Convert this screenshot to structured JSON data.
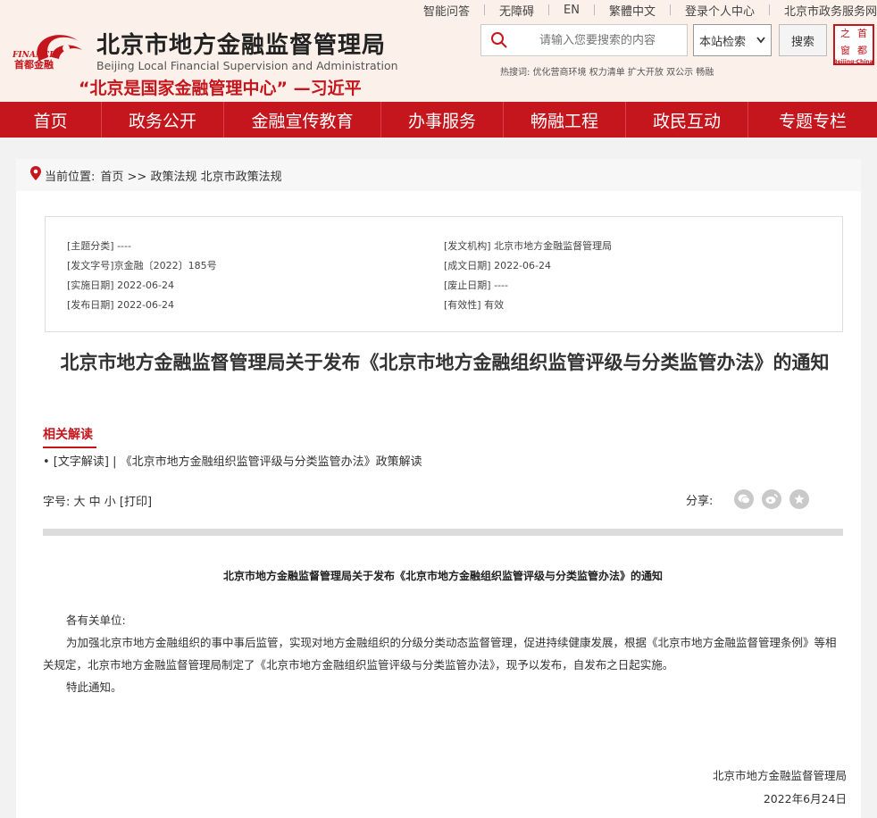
{
  "topbar": {
    "items": [
      "智能问答",
      "无障碍",
      "EN",
      "繁體中文",
      "登录个人中心",
      "北京市政务服务网"
    ]
  },
  "header": {
    "logo_text_en": "FINANCE",
    "logo_text_cn": "首都金融",
    "site_name_cn": "北京市地方金融监督管理局",
    "site_name_en": "Beijing Local Financial Supervision and Administration",
    "slogan": "“北京是国家金融管理中心” —习近平",
    "search_placeholder": "请输入您要搜索的内容",
    "search_scope": "本站检索",
    "search_button": "搜索",
    "hot_label": "热搜词:",
    "hot_words": "优化营商环境 权力清单 扩大开放 双公示 畅融",
    "stamp_chars": [
      "首",
      "都",
      "之",
      "窗"
    ],
    "stamp_en": "Beijing·China"
  },
  "nav": {
    "items": [
      "首页",
      "政务公开",
      "金融宣传教育",
      "办事服务",
      "畅融工程",
      "政民互动",
      "专题专栏"
    ]
  },
  "breadcrumb": {
    "label": "当前位置:",
    "path": "首页 >> 政策法规 北京市政策法规"
  },
  "meta": {
    "subject_category": "[主题分类] ----",
    "doc_number": "[发文字号]京金融〔2022〕185号",
    "effective_date": "[实施日期] 2022-06-24",
    "publish_date": "[发布日期] 2022-06-24",
    "issuing_body": "[发文机构] 北京市地方金融监督管理局",
    "written_date": "[成文日期] 2022-06-24",
    "repeal_date": "[废止日期] ----",
    "validity": "[有效性] 有效"
  },
  "article": {
    "title": "北京市地方金融监督管理局关于发布《北京市地方金融组织监管评级与分类监管办法》的通知",
    "related_heading": "相关解读",
    "related_item_tag": "• [文字解读] |",
    "related_item_text": "《北京市地方金融组织监管评级与分类监管办法》政策解读",
    "font_size_label": "字号: 大 中 小 [打印]",
    "share_label": "分享:",
    "doc_title": "北京市地方金融监督管理局关于发布《北京市地方金融组织监管评级与分类监管办法》的通知",
    "salutation": "各有关单位:",
    "paragraph": "为加强北京市地方金融组织的事中事后监管，实现对地方金融组织的分级分类动态监督管理，促进持续健康发展，根据《北京市地方金融监督管理条例》等相关规定，北京市地方金融监督管理局制定了《北京市地方金融组织监管评级与分类监管办法》，现予以发布，自发布之日起实施。",
    "closing": "特此通知。",
    "signature_org": "北京市地方金融监督管理局",
    "signature_date": "2022年6月24日"
  },
  "colors": {
    "brand_red": "#c4161c",
    "header_bg": "#fbf1ea",
    "page_bg": "#f2f2f2"
  }
}
